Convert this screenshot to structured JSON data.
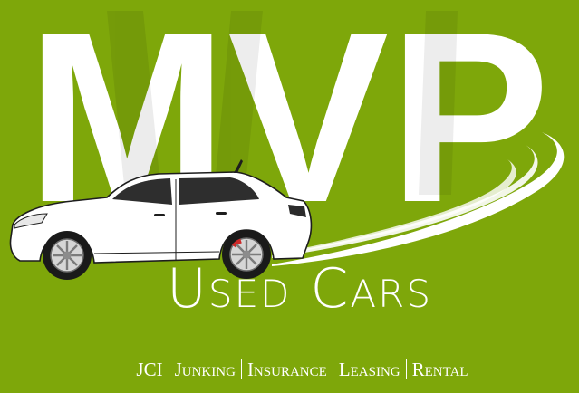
{
  "brand": {
    "name": "MVP",
    "subtitle": "Used Cars",
    "services": [
      "JCI",
      "Junking",
      "Insurance",
      "Leasing",
      "Rental"
    ]
  },
  "colors": {
    "background": "#7ea70a",
    "foreground": "#ffffff",
    "car_outline": "#1d1d1d",
    "car_window": "#2e2e2e",
    "brake_caliper": "#cc2a2a"
  },
  "icons": [
    "car-icon",
    "road-swoosh"
  ]
}
